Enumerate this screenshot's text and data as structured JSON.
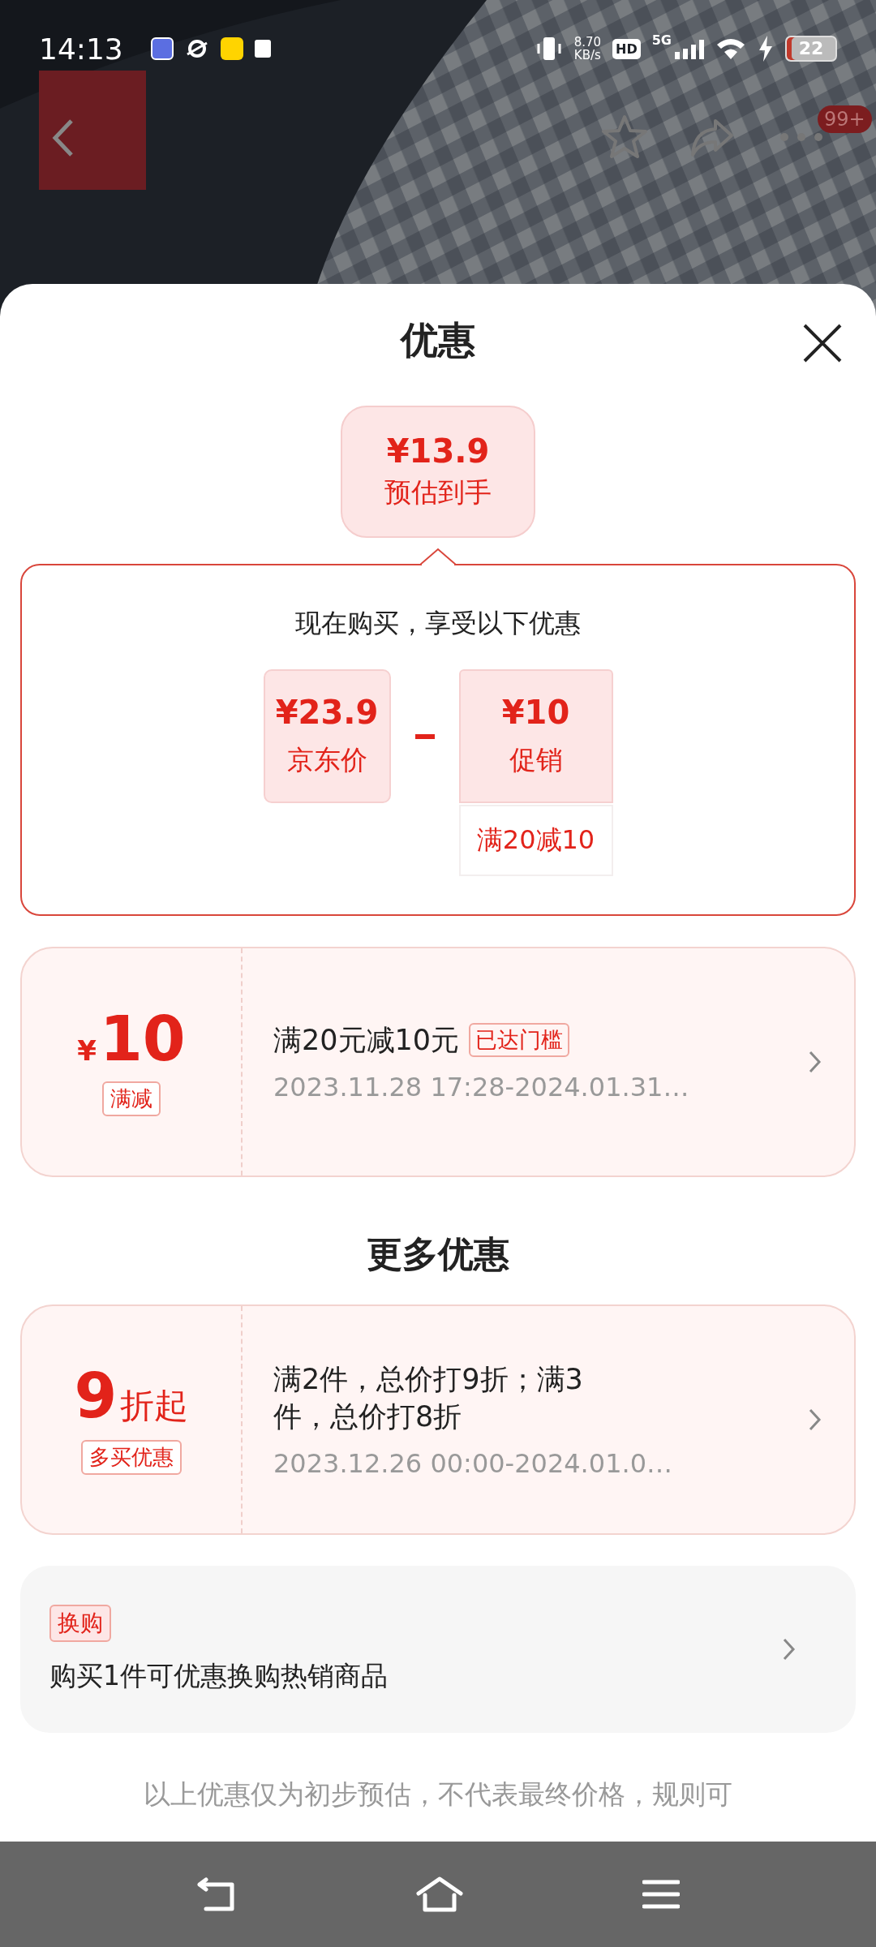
{
  "status_bar": {
    "time": "14:13",
    "net_speed": "8.70",
    "net_unit": "KB/s",
    "hd": "HD",
    "network": "5G",
    "battery": "22"
  },
  "header": {
    "badge": "99+"
  },
  "sheet": {
    "title": "优惠"
  },
  "estimate": {
    "price": "¥13.9",
    "label": "预估到手"
  },
  "breakdown": {
    "heading": "现在购买，享受以下优惠",
    "items": [
      {
        "price": "¥23.9",
        "label": "京东价"
      },
      {
        "price": "¥10",
        "label": "促销",
        "note": "满20减10"
      }
    ]
  },
  "coupons": [
    {
      "currency": "¥",
      "amount": "10",
      "tag": "满减",
      "title": "满20元减10元",
      "badge": "已达门槛",
      "period": "2023.11.28 17:28-2024.01.31…"
    }
  ],
  "more_offers": {
    "title": "更多优惠",
    "coupons": [
      {
        "amount": "9",
        "unit": "折起",
        "tag": "多买优惠",
        "title": "满2件，总价打9折；满3件，总价打8折",
        "period": "2023.12.26 00:00-2024.01.0…"
      }
    ]
  },
  "exchange": {
    "tag": "换购",
    "text": "购买1件可优惠换购热销商品"
  },
  "footer_note": "以上优惠仅为初步预估，不代表最终价格，规则可"
}
